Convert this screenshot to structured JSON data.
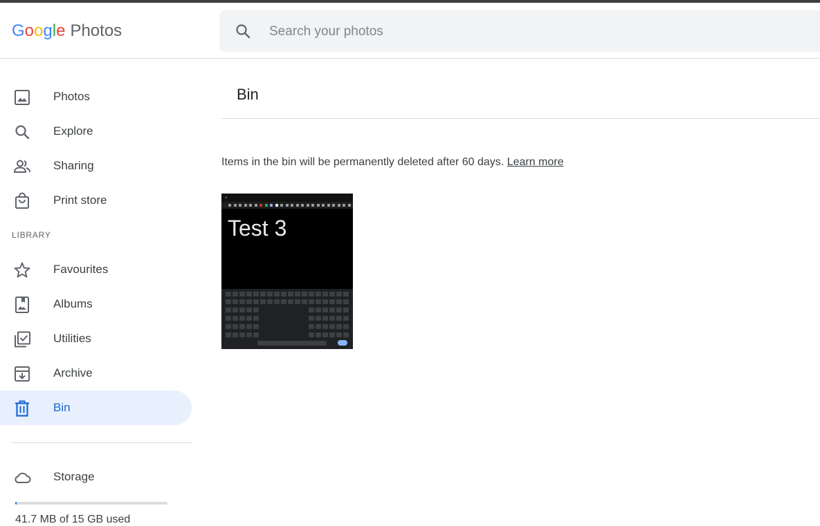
{
  "app": {
    "name_parts": [
      "G",
      "o",
      "o",
      "g",
      "l",
      "e"
    ],
    "product": "Photos"
  },
  "search": {
    "placeholder": "Search your photos",
    "value": ""
  },
  "sidebar": {
    "items": [
      {
        "label": "Photos",
        "icon": "photo-icon"
      },
      {
        "label": "Explore",
        "icon": "search-icon"
      },
      {
        "label": "Sharing",
        "icon": "people-icon"
      },
      {
        "label": "Print store",
        "icon": "shopping-bag-icon"
      }
    ],
    "library_label": "LIBRARY",
    "library_items": [
      {
        "label": "Favourites",
        "icon": "star-icon"
      },
      {
        "label": "Albums",
        "icon": "album-icon"
      },
      {
        "label": "Utilities",
        "icon": "utilities-icon"
      },
      {
        "label": "Archive",
        "icon": "archive-icon"
      },
      {
        "label": "Bin",
        "icon": "trash-icon",
        "active": true
      }
    ],
    "storage": {
      "label": "Storage",
      "icon": "cloud-icon",
      "used_text": "41.7 MB of 15 GB used",
      "used_fraction": 0.003
    }
  },
  "main": {
    "title": "Bin",
    "info_text": "Items in the bin will be permanently deleted after 60 days.",
    "learn_more": "Learn more",
    "items": [
      {
        "thumbnail_text": "Test 3"
      }
    ]
  },
  "colors": {
    "accent": "#1a73e8",
    "active_bg": "#e8f0fe",
    "active_text": "#1967d2"
  }
}
